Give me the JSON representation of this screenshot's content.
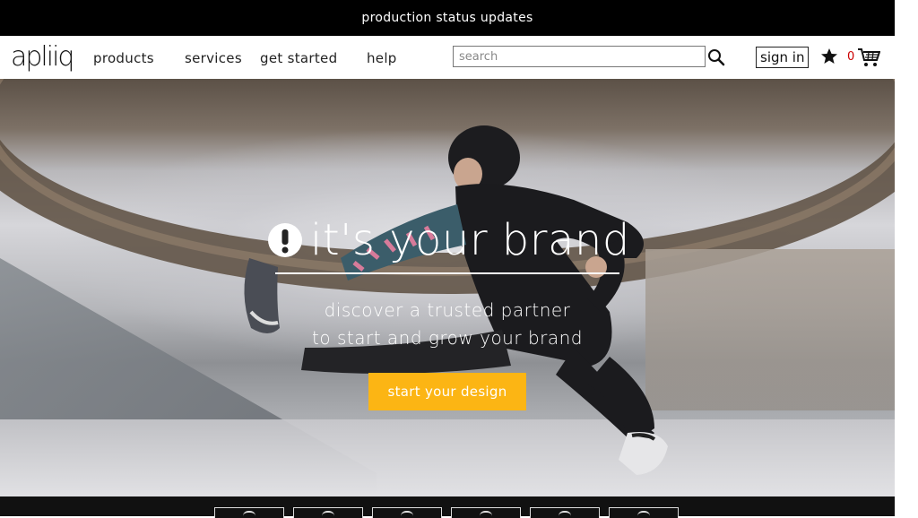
{
  "announcement": "production status updates",
  "brand": {
    "logo_text": "apliiq"
  },
  "nav": {
    "items": [
      {
        "label": "products"
      },
      {
        "label": "services"
      },
      {
        "label": "get started"
      },
      {
        "label": "help"
      }
    ],
    "search_placeholder": "search",
    "signin_label": "sign in",
    "cart_count": "0"
  },
  "hero": {
    "title": "it's your brand",
    "subtitle_line1": "discover a trusted partner",
    "subtitle_line2": "to start and grow your brand",
    "cta_label": "start your design"
  },
  "colors": {
    "cta": "#fcb514",
    "cart_count": "#cc0000",
    "topbar": "#000000"
  },
  "icons": [
    "search-icon",
    "star-icon",
    "cart-icon",
    "alert-icon"
  ]
}
